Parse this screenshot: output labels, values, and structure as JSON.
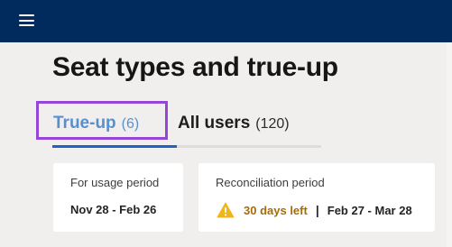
{
  "header": {
    "menu_icon": "hamburger-menu-icon",
    "background_color": "#002b5c"
  },
  "page": {
    "title": "Seat types and true-up"
  },
  "tabs": [
    {
      "label": "True-up",
      "count": "(6)",
      "active": true
    },
    {
      "label": "All users",
      "count": "(120)",
      "active": false
    }
  ],
  "colors": {
    "active_tab": "#5a8fcf",
    "active_underline": "#1d63c5",
    "highlight": "#9646d6",
    "warning": "#f1b51c",
    "days_left": "#a36c0b"
  },
  "cards": {
    "usage": {
      "label": "For usage period",
      "value": "Nov 28 - Feb 26"
    },
    "reconciliation": {
      "label": "Reconciliation period",
      "icon": "warning-icon",
      "days_left": "30 days left",
      "separator": "|",
      "range": "Feb 27 - Mar 28"
    }
  }
}
